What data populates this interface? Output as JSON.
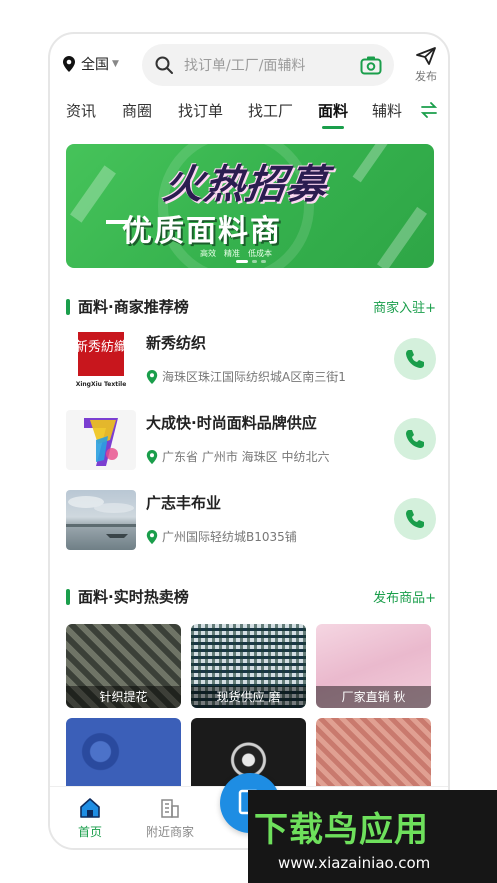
{
  "header": {
    "location": "全国",
    "search_placeholder": "找订单/工厂/面辅料",
    "publish_label": "发布"
  },
  "tabs": [
    "资讯",
    "商圈",
    "找订单",
    "找工厂",
    "面料",
    "辅料"
  ],
  "active_tab": "面料",
  "banner": {
    "title_top": "火热招募",
    "title_bottom": "优质面料商",
    "tags": [
      "高效",
      "精准",
      "低成本"
    ]
  },
  "section_merchants": {
    "title": "面料·商家推荐榜",
    "more": "商家入驻+",
    "items": [
      {
        "name": "新秀纺织",
        "address": "海珠区珠江国际纺织城A区南三街1",
        "logo_text": "新秀紡織",
        "logo_sub": "XingXiu Textile"
      },
      {
        "name": "大成快·时尚面料品牌供应",
        "address": "广东省 广州市 海珠区 中纺北六"
      },
      {
        "name": "广志丰布业",
        "address": "广州国际轻纺城B1035铺"
      }
    ]
  },
  "section_hot": {
    "title": "面料·实时热卖榜",
    "more": "发布商品+",
    "items": [
      {
        "caption": "针织提花"
      },
      {
        "caption": "现货供应 磨"
      },
      {
        "caption": "厂家直销 秋"
      },
      {
        "caption": ""
      },
      {
        "caption": ""
      },
      {
        "caption": ""
      }
    ]
  },
  "bottom_nav": {
    "home": "首页",
    "nearby": "附近商家"
  },
  "watermark": {
    "title": "下载鸟应用",
    "url": "www.xiazainiao.com"
  },
  "colors": {
    "accent": "#1a9e4b",
    "fab": "#1e8de3",
    "call_bg": "#d4f0dc"
  }
}
